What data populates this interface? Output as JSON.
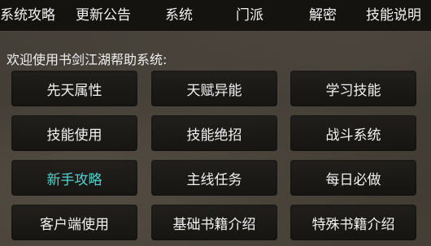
{
  "tabs": [
    "系统攻略",
    "更新公告",
    "系统",
    "门派",
    "解密",
    "技能说明"
  ],
  "welcome": "欢迎使用书剑江湖帮助系统:",
  "buttons": [
    [
      "先天属性",
      "天赋异能",
      "学习技能"
    ],
    [
      "技能使用",
      "技能绝招",
      "战斗系统"
    ],
    [
      "新手攻略",
      "主线任务",
      "每日必做"
    ],
    [
      "客户端使用",
      "基础书籍介绍",
      "特殊书籍介绍"
    ]
  ],
  "highlight_color": "#4fd1cf",
  "active_button": "新手攻略"
}
